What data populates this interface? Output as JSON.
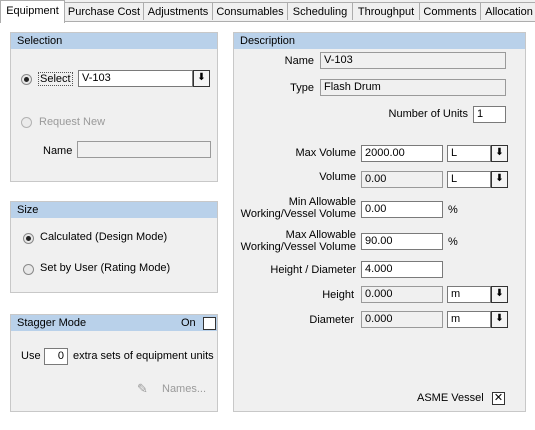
{
  "tabs": [
    {
      "label": "Equipment"
    },
    {
      "label": "Purchase Cost"
    },
    {
      "label": "Adjustments"
    },
    {
      "label": "Consumables"
    },
    {
      "label": "Scheduling"
    },
    {
      "label": "Throughput"
    },
    {
      "label": "Comments"
    },
    {
      "label": "Allocation"
    }
  ],
  "selection": {
    "title": "Selection",
    "select_label": "Select",
    "select_value": "V-103",
    "request_new_label": "Request New",
    "name_label": "Name",
    "name_value": ""
  },
  "size": {
    "title": "Size",
    "calculated_label": "Calculated (Design Mode)",
    "set_by_user_label": "Set by User (Rating Mode)"
  },
  "stagger": {
    "title": "Stagger Mode",
    "on_label": "On",
    "use_label": "Use",
    "count": "0",
    "suffix": "extra sets of equipment units",
    "names_label": "Names..."
  },
  "description": {
    "title": "Description",
    "name_label": "Name",
    "name_value": "V-103",
    "type_label": "Type",
    "type_value": "Flash Drum",
    "units_label": "Number of Units",
    "units_value": "1",
    "max_volume_label": "Max Volume",
    "max_volume_value": "2000.00",
    "max_volume_unit": "L",
    "volume_label": "Volume",
    "volume_value": "0.00",
    "volume_unit": "L",
    "min_ratio_label_1": "Min Allowable",
    "min_ratio_label_2": "Working/Vessel Volume",
    "min_ratio_value": "0.00",
    "min_ratio_unit": "%",
    "max_ratio_label_1": "Max Allowable",
    "max_ratio_label_2": "Working/Vessel Volume",
    "max_ratio_value": "90.00",
    "max_ratio_unit": "%",
    "hd_label": "Height / Diameter",
    "hd_value": "4.000",
    "height_label": "Height",
    "height_value": "0.000",
    "height_unit": "m",
    "diameter_label": "Diameter",
    "diameter_value": "0.000",
    "diameter_unit": "m",
    "asme_label": "ASME Vessel",
    "asme_checked_glyph": "✕"
  }
}
